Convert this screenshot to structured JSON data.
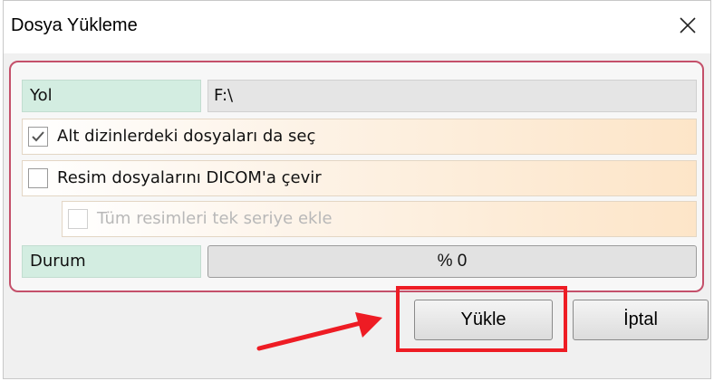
{
  "window": {
    "title": "Dosya Yükleme",
    "close_icon": "close-icon"
  },
  "fields": {
    "path_label": "Yol",
    "path_value": "F:\\",
    "status_label": "Durum",
    "progress_text": "% 0",
    "progress_fraction": 0
  },
  "options": {
    "include_subdirs": {
      "label": "Alt dizinlerdeki dosyaları da seç",
      "checked": true,
      "enabled": true
    },
    "convert_dicom": {
      "label": "Resim dosyalarını DICOM'a çevir",
      "checked": false,
      "enabled": true
    },
    "single_series": {
      "label": "Tüm resimleri tek seriye ekle",
      "checked": false,
      "enabled": false
    }
  },
  "buttons": {
    "upload": "Yükle",
    "cancel": "İptal"
  },
  "colors": {
    "group_border": "#c4506a",
    "label_bg": "#d3ede1",
    "annotation_red": "#ee1c24"
  }
}
